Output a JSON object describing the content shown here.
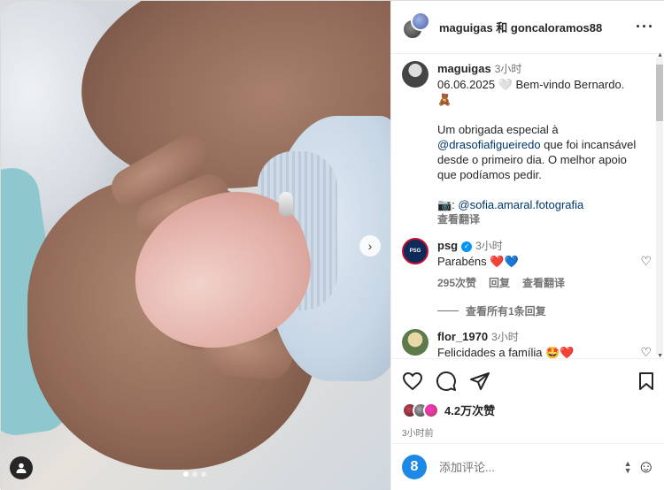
{
  "header": {
    "title": "maguigas 和 goncaloramos88"
  },
  "caption": {
    "username": "maguigas",
    "time": "3小时",
    "line1": "06.06.2025 🤍 Bem-vindo Bernardo.",
    "emoji": "🧸",
    "para2_before": "Um obrigada especial à ",
    "mention": "@drasofiafigueiredo",
    "para2_after": " que foi incansável desde o primeiro dia. O melhor apoio que podíamos pedir.",
    "photo_prefix": "📷: ",
    "photo_credit": "@sofia.amaral.fotografia",
    "translate": "查看翻译"
  },
  "comments": [
    {
      "username": "psg",
      "time": "3小时",
      "text": "Parabéns ❤️💙",
      "likes": "295次赞",
      "reply": "回复",
      "translate": "查看翻译",
      "view_replies": "查看所有1条回复"
    },
    {
      "username": "flor_1970",
      "time": "3小时",
      "text": "Felicidades a família 🤩❤️"
    }
  ],
  "actions": {
    "likes_count": "4.2万次赞",
    "post_time": "3小时前"
  },
  "comment_box": {
    "placeholder": "添加评论..."
  },
  "colors": {
    "accent": "#0095f6",
    "mention": "#00376b",
    "muted": "#737373"
  }
}
